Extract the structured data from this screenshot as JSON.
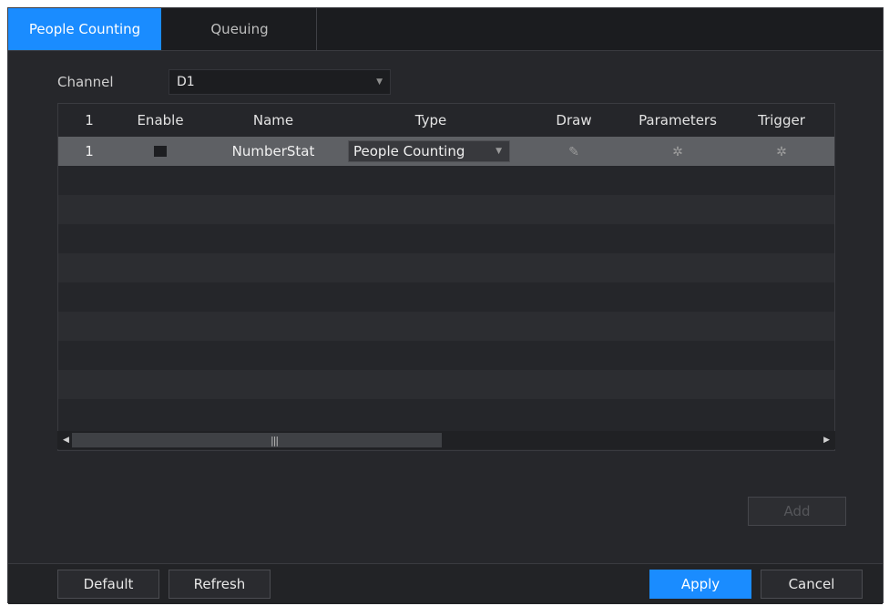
{
  "tabs": [
    {
      "label": "People Counting",
      "active": true
    },
    {
      "label": "Queuing",
      "active": false
    }
  ],
  "channel": {
    "label": "Channel",
    "value": "D1"
  },
  "table": {
    "headers": [
      "1",
      "Enable",
      "Name",
      "Type",
      "Draw",
      "Parameters",
      "Trigger"
    ],
    "rows": [
      {
        "index": "1",
        "enabled": false,
        "name": "NumberStat",
        "type": "People Counting",
        "draw_icon": "pencil-icon",
        "parameters_icon": "gear-icon",
        "trigger_icon": "gear-icon"
      }
    ]
  },
  "buttons": {
    "add": "Add",
    "default": "Default",
    "refresh": "Refresh",
    "apply": "Apply",
    "cancel": "Cancel"
  },
  "colors": {
    "accent": "#1a8cff",
    "background": "#26272b",
    "selected_row": "#5e6064"
  }
}
